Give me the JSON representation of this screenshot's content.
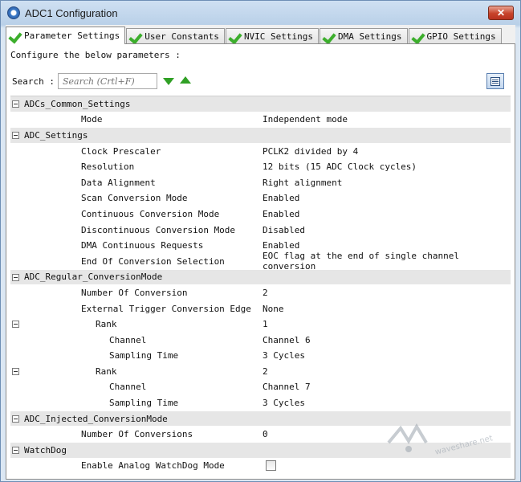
{
  "window": {
    "title": "ADC1 Configuration",
    "close_label": "✕"
  },
  "tabs": [
    {
      "label": "Parameter Settings",
      "active": true
    },
    {
      "label": "User Constants",
      "active": false
    },
    {
      "label": "NVIC Settings",
      "active": false
    },
    {
      "label": "DMA Settings",
      "active": false
    },
    {
      "label": "GPIO Settings",
      "active": false
    }
  ],
  "panel": {
    "intro": "Configure the below parameters :",
    "search_label": "Search :",
    "search_placeholder": "Search (Crtl+F)"
  },
  "tree": [
    {
      "type": "group",
      "label": "ADCs_Common_Settings"
    },
    {
      "type": "param",
      "indent": 1,
      "name": "Mode",
      "value": "Independent mode"
    },
    {
      "type": "group",
      "label": "ADC_Settings"
    },
    {
      "type": "param",
      "indent": 1,
      "name": "Clock Prescaler",
      "value": "PCLK2 divided by 4"
    },
    {
      "type": "param",
      "indent": 1,
      "name": "Resolution",
      "value": "12 bits (15 ADC Clock cycles)"
    },
    {
      "type": "param",
      "indent": 1,
      "name": "Data Alignment",
      "value": "Right alignment"
    },
    {
      "type": "param",
      "indent": 1,
      "name": "Scan Conversion Mode",
      "value": "Enabled"
    },
    {
      "type": "param",
      "indent": 1,
      "name": "Continuous Conversion Mode",
      "value": "Enabled"
    },
    {
      "type": "param",
      "indent": 1,
      "name": "Discontinuous Conversion Mode",
      "value": "Disabled"
    },
    {
      "type": "param",
      "indent": 1,
      "name": "DMA Continuous Requests",
      "value": "Enabled"
    },
    {
      "type": "param",
      "indent": 1,
      "name": "End Of Conversion Selection",
      "value": "EOC flag at the end of single channel conversion"
    },
    {
      "type": "group",
      "label": "ADC_Regular_ConversionMode"
    },
    {
      "type": "param",
      "indent": 1,
      "name": "Number Of Conversion",
      "value": "2"
    },
    {
      "type": "param",
      "indent": 1,
      "name": "External Trigger Conversion Edge",
      "value": "None"
    },
    {
      "type": "subgroup",
      "indent": 2,
      "name": "Rank",
      "value": "1"
    },
    {
      "type": "param",
      "indent": 3,
      "name": "Channel",
      "value": "Channel 6"
    },
    {
      "type": "param",
      "indent": 3,
      "name": "Sampling Time",
      "value": "3 Cycles"
    },
    {
      "type": "subgroup",
      "indent": 2,
      "name": "Rank",
      "value": "2"
    },
    {
      "type": "param",
      "indent": 3,
      "name": "Channel",
      "value": "Channel 7"
    },
    {
      "type": "param",
      "indent": 3,
      "name": "Sampling Time",
      "value": "3 Cycles"
    },
    {
      "type": "group",
      "label": "ADC_Injected_ConversionMode"
    },
    {
      "type": "param",
      "indent": 1,
      "name": "Number Of Conversions",
      "value": "0"
    },
    {
      "type": "group",
      "label": "WatchDog"
    },
    {
      "type": "checkbox",
      "indent": 1,
      "name": "Enable Analog WatchDog Mode",
      "checked": false
    }
  ],
  "watermark": {
    "text": "waveshare.net"
  }
}
